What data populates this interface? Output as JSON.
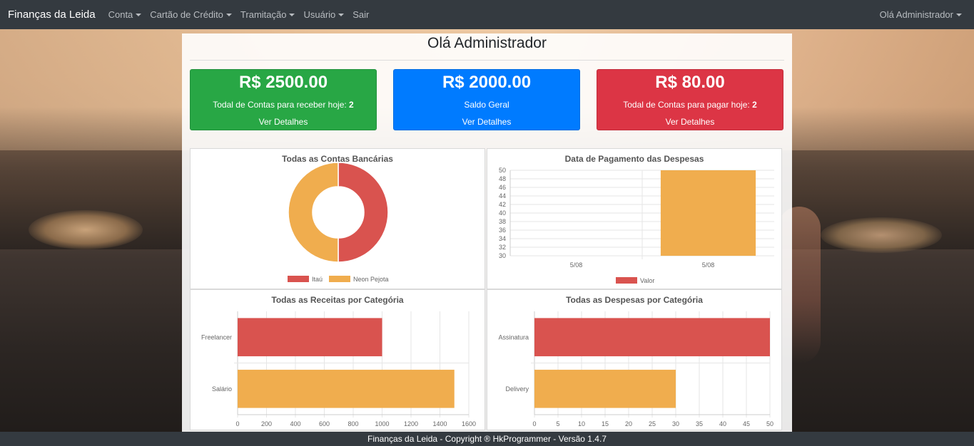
{
  "navbar": {
    "brand": "Finanças da Leida",
    "items": [
      {
        "label": "Conta",
        "dropdown": true
      },
      {
        "label": "Cartão de Crédito",
        "dropdown": true
      },
      {
        "label": "Tramitação",
        "dropdown": true
      },
      {
        "label": "Usuário",
        "dropdown": true
      },
      {
        "label": "Sair",
        "dropdown": false
      }
    ],
    "user_menu": "Olá Administrador"
  },
  "page": {
    "title": "Olá Administrador"
  },
  "cards": [
    {
      "amount": "R$ 2500.00",
      "text": "Todal de Contas para receber hoje:",
      "count": "2",
      "link": "Ver Detalhes",
      "color": "#28a745"
    },
    {
      "amount": "R$ 2000.00",
      "text": "Saldo Geral",
      "count": "",
      "link": "Ver Detalhes",
      "color": "#007bff"
    },
    {
      "amount": "R$ 80.00",
      "text": "Todal de Contas para pagar hoje:",
      "count": "2",
      "link": "Ver Detalhes",
      "color": "#dc3545"
    }
  ],
  "colors": {
    "red": "#d9534f",
    "orange": "#f0ad4e"
  },
  "chart_data": [
    {
      "type": "pie",
      "title": "Todas as Contas Bancárias",
      "categories": [
        "Itaú",
        "Neon Pejota"
      ],
      "values": [
        50,
        50
      ],
      "legend": "bottom"
    },
    {
      "type": "bar",
      "title": "Data de Pagamento das Despesas",
      "categories": [
        "5/08",
        "5/08"
      ],
      "series": [
        {
          "name": "Valor",
          "values": [
            30,
            50
          ]
        }
      ],
      "ylim": [
        30,
        50
      ],
      "yticks": [
        "50",
        "48",
        "46",
        "44",
        "42",
        "40",
        "38",
        "36",
        "34",
        "32",
        "30"
      ],
      "legend": "bottom"
    },
    {
      "type": "bar",
      "orientation": "horizontal",
      "title": "Todas as Receitas por Categória",
      "categories": [
        "Freelancer",
        "Salário"
      ],
      "values": [
        1000,
        1500
      ],
      "xlim": [
        0,
        1600
      ],
      "xticks": [
        "0",
        "200",
        "400",
        "600",
        "800",
        "1000",
        "1200",
        "1400",
        "1600"
      ]
    },
    {
      "type": "bar",
      "orientation": "horizontal",
      "title": "Todas as Despesas por Categória",
      "categories": [
        "Assinatura",
        "Delivery"
      ],
      "values": [
        50,
        30
      ],
      "xlim": [
        0,
        50
      ],
      "xticks": [
        "0",
        "5",
        "10",
        "15",
        "20",
        "25",
        "30",
        "35",
        "40",
        "45",
        "50"
      ]
    }
  ],
  "footer": {
    "text": "Finanças da Leida - Copyright ® HkProgrammer - Versão 1.4.7"
  }
}
